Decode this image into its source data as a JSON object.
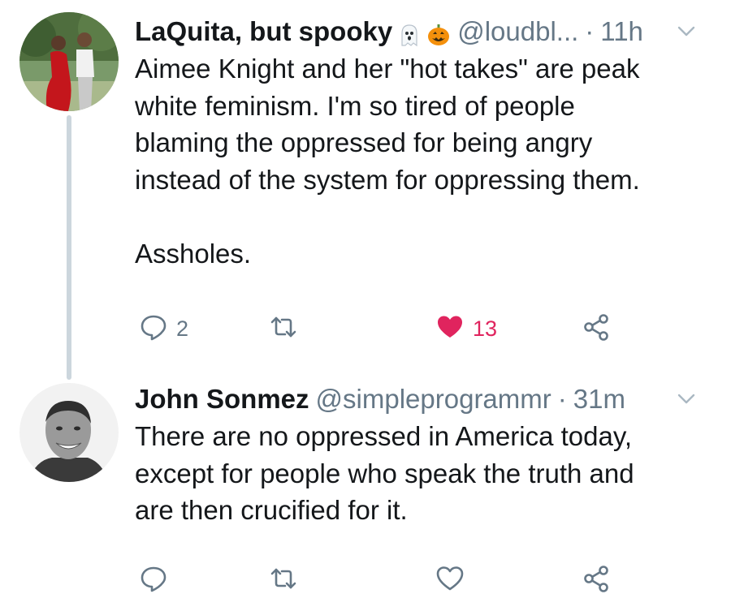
{
  "tweets": [
    {
      "author_name": "LaQuita, but spooky",
      "name_emojis": [
        "ghost-emoji",
        "jack-o-lantern-emoji"
      ],
      "handle": "@loudbl...",
      "separator": "·",
      "time": "11h",
      "text": "Aimee Knight and her \"hot takes\" are peak\nwhite feminism. I'm so tired of people\nblaming the oppressed for being angry\ninstead of the system for oppressing them.\n\nAssholes.",
      "reply_count": "2",
      "retweet_count": "",
      "like_count": "13",
      "liked": true
    },
    {
      "author_name": "John Sonmez",
      "handle": "@simpleprogrammr",
      "separator": "·",
      "time": "31m",
      "text": "There are no oppressed in America today,\nexcept for people who speak the truth and\nare then crucified for it.",
      "reply_count": "",
      "retweet_count": "",
      "like_count": "",
      "liked": false
    }
  ],
  "icons": [
    "reply-icon",
    "retweet-icon",
    "heart-icon",
    "share-icon",
    "chevron-down-icon"
  ],
  "colors": {
    "text": "#14171a",
    "secondary": "#657786",
    "like": "#e0245e",
    "thread_line": "#ccd6dd"
  }
}
